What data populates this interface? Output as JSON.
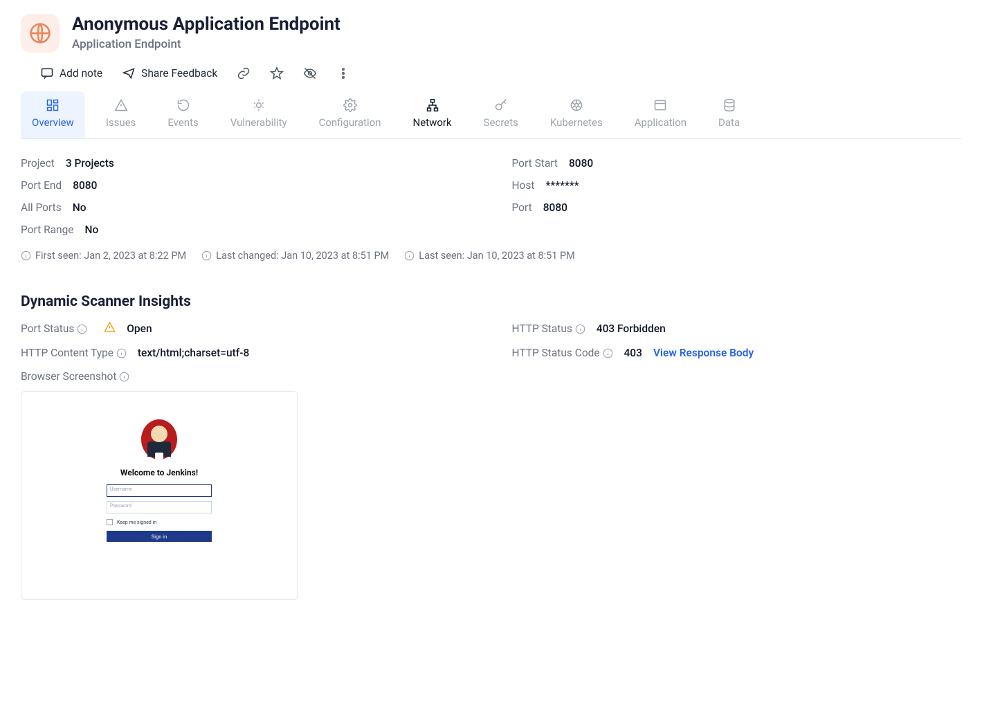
{
  "header": {
    "title": "Anonymous Application Endpoint",
    "subtitle": "Application Endpoint"
  },
  "toolbar": {
    "add_note": "Add note",
    "share_feedback": "Share Feedback"
  },
  "tabs": [
    {
      "id": "overview",
      "label": "Overview",
      "active": true
    },
    {
      "id": "issues",
      "label": "Issues"
    },
    {
      "id": "events",
      "label": "Events"
    },
    {
      "id": "vulnerability",
      "label": "Vulnerability"
    },
    {
      "id": "configuration",
      "label": "Configuration"
    },
    {
      "id": "network",
      "label": "Network",
      "dark": true
    },
    {
      "id": "secrets",
      "label": "Secrets"
    },
    {
      "id": "kubernetes",
      "label": "Kubernetes"
    },
    {
      "id": "application",
      "label": "Application"
    },
    {
      "id": "data",
      "label": "Data"
    }
  ],
  "details": {
    "project_label": "Project",
    "project_value": "3 Projects",
    "port_start_label": "Port Start",
    "port_start_value": "8080",
    "port_end_label": "Port End",
    "port_end_value": "8080",
    "host_label": "Host",
    "host_value": "*******",
    "all_ports_label": "All Ports",
    "all_ports_value": "No",
    "port_label": "Port",
    "port_value": "8080",
    "port_range_label": "Port Range",
    "port_range_value": "No"
  },
  "timestamps": {
    "first_seen": "First seen: Jan 2, 2023 at 8:22 PM",
    "last_changed": "Last changed: Jan 10, 2023 at 8:51 PM",
    "last_seen": "Last seen: Jan 10, 2023 at 8:51 PM"
  },
  "scanner": {
    "heading": "Dynamic Scanner Insights",
    "port_status_label": "Port Status",
    "port_status_value": "Open",
    "http_status_label": "HTTP Status",
    "http_status_value": "403 Forbidden",
    "content_type_label": "HTTP Content Type",
    "content_type_value": "text/html;charset=utf-8",
    "status_code_label": "HTTP Status Code",
    "status_code_value": "403",
    "view_body": "View Response Body",
    "screenshot_label": "Browser Screenshot"
  },
  "screenshot": {
    "title": "Welcome to Jenkins!",
    "username_ph": "Username",
    "password_ph": "Password",
    "keep": "Keep me signed in",
    "signin": "Sign in"
  }
}
